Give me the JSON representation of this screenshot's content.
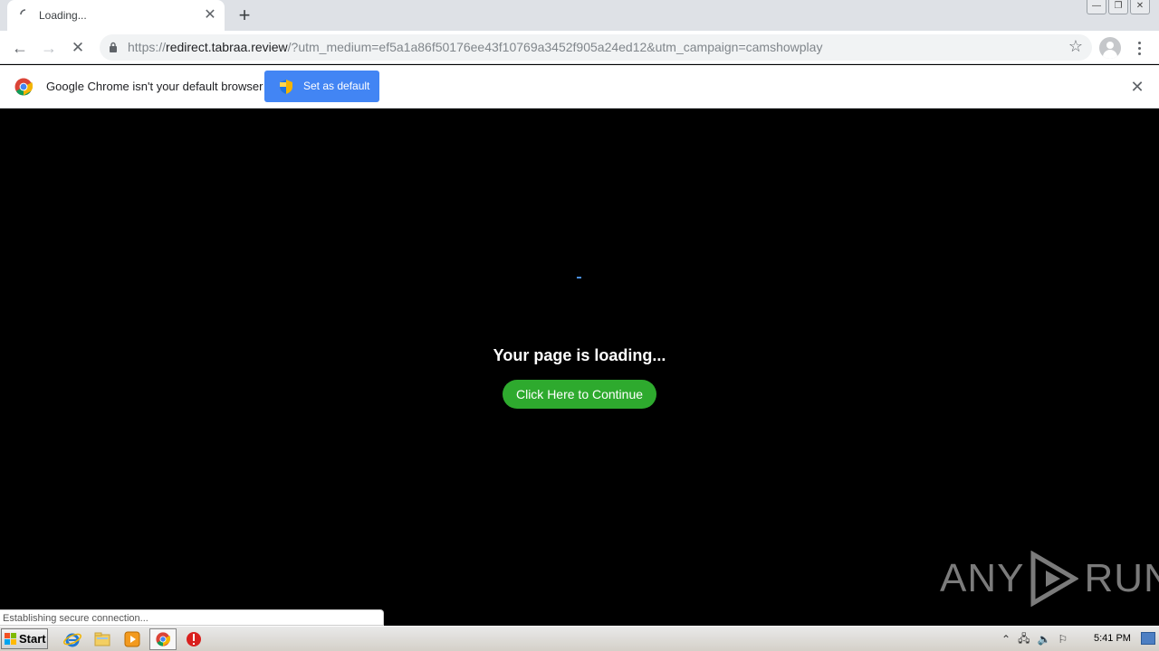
{
  "tab": {
    "title": "Loading..."
  },
  "toolbar": {
    "url_scheme": "https://",
    "url_host": "redirect.tabraa.review",
    "url_rest": "/?utm_medium=ef5a1a86f50176ee43f10769a3452f905a24ed12&utm_campaign=camshowplay"
  },
  "infobar": {
    "message": "Google Chrome isn't your default browser",
    "button_label": "Set as default"
  },
  "page": {
    "loading_text": "Your page is loading...",
    "continue_label": "Click Here to Continue",
    "watermark_left": "ANY",
    "watermark_right": "RUN"
  },
  "status": {
    "text": "Establishing secure connection..."
  },
  "taskbar": {
    "start_label": "Start",
    "clock": "5:41 PM"
  },
  "colors": {
    "accent": "#4285f4",
    "continue_green": "#2eaa2e",
    "page_bg": "#000000"
  }
}
